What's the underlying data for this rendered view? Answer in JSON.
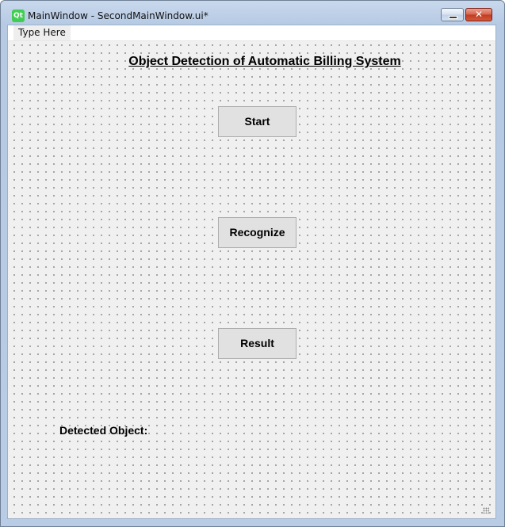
{
  "window": {
    "logo_text": "Qt",
    "title": "MainWindow - SecondMainWindow.ui*",
    "minimize_symbol": "",
    "close_symbol": "✕"
  },
  "menubar": {
    "items": [
      {
        "label": "Type Here"
      }
    ]
  },
  "form": {
    "title": "Object Detection of Automatic Billing System",
    "buttons": {
      "start": "Start",
      "recognize": "Recognize",
      "result": "Result"
    },
    "detected_label": "Detected Object:"
  },
  "colors": {
    "qt_green": "#41cd52",
    "close_red": "#c13b22",
    "button_face": "#e1e1e1",
    "form_background": "#f0f0f0"
  },
  "icons": {
    "logo": "qt-logo-icon",
    "minimize": "minimize-icon",
    "close": "close-icon",
    "resize_grip": "resize-grip-icon"
  }
}
